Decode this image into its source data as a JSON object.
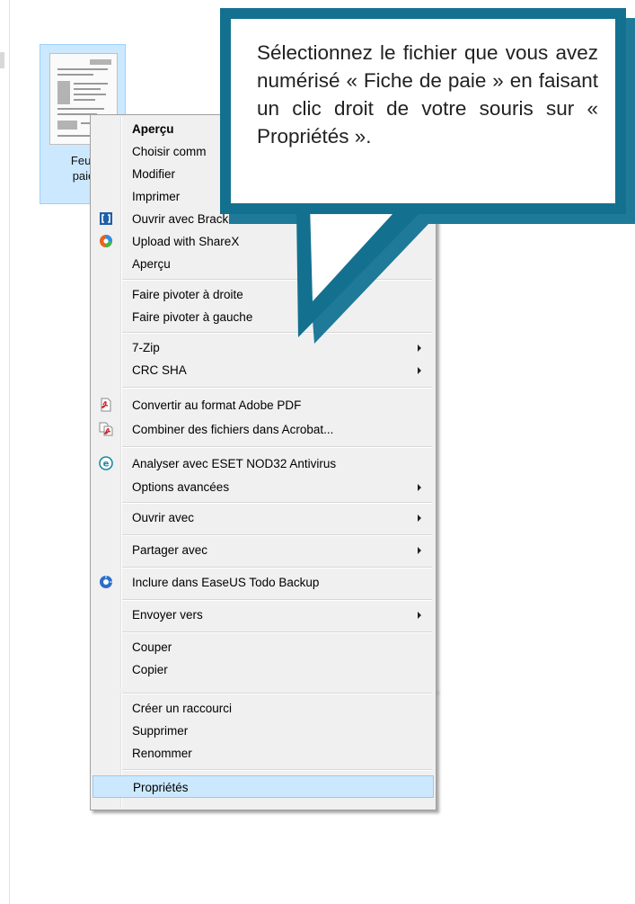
{
  "file": {
    "label_line1": "Feuil",
    "label_line2": "paie"
  },
  "menu": {
    "items": [
      {
        "label": "Aperçu",
        "bold": true
      },
      {
        "label": "Choisir comm"
      },
      {
        "label": "Modifier"
      },
      {
        "label": "Imprimer"
      },
      {
        "label": "Ouvrir avec Brackets",
        "icon": "brackets-icon"
      },
      {
        "label": "Upload with ShareX",
        "icon": "sharex-icon"
      },
      {
        "label": "Aperçu"
      },
      {
        "label": "Faire pivoter à droite"
      },
      {
        "label": "Faire pivoter à gauche"
      },
      {
        "label": "7-Zip",
        "submenu": true
      },
      {
        "label": "CRC SHA",
        "submenu": true
      },
      {
        "label": "Convertir au format Adobe PDF",
        "icon": "adobe-pdf-icon"
      },
      {
        "label": "Combiner des fichiers dans Acrobat...",
        "icon": "acrobat-combine-icon"
      },
      {
        "label": "Analyser avec ESET NOD32 Antivirus",
        "icon": "eset-icon"
      },
      {
        "label": "Options avancées",
        "submenu": true
      },
      {
        "label": "Ouvrir avec",
        "submenu": true
      },
      {
        "label": "Partager avec",
        "submenu": true
      },
      {
        "label": "Inclure dans EaseUS Todo Backup",
        "icon": "easeus-icon"
      },
      {
        "label": "Envoyer vers",
        "submenu": true
      },
      {
        "label": "Couper"
      },
      {
        "label": "Copier"
      },
      {
        "label": "Créer un raccourci"
      },
      {
        "label": "Supprimer"
      },
      {
        "label": "Renommer"
      },
      {
        "label": "Propriétés",
        "highlighted": true
      }
    ]
  },
  "callout": {
    "text": "Sélectionnez le fichier que vous avez numérisé « Fiche de paie » en faisant un clic droit de votre souris sur « Propriétés »."
  },
  "colors": {
    "callout_border": "#13718f",
    "selection": "#cce8ff"
  }
}
